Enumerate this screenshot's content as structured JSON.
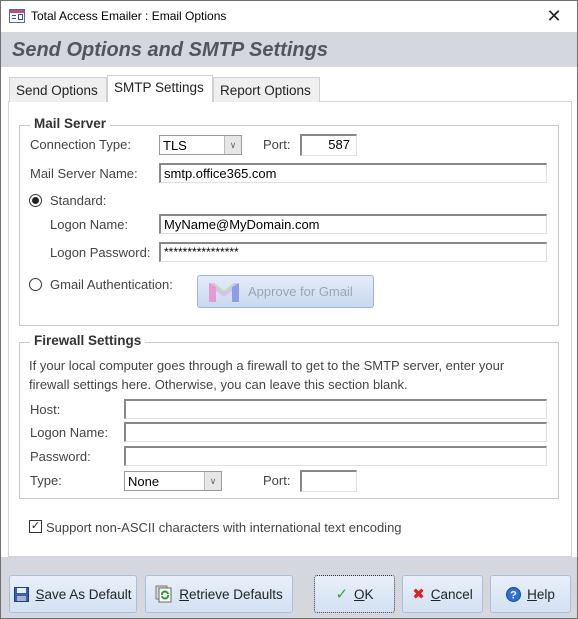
{
  "window": {
    "title": "Total Access Emailer : Email Options",
    "close_glyph": "✕"
  },
  "header": {
    "title": "Send Options and SMTP Settings"
  },
  "tabs": [
    {
      "label": "Send Options",
      "active": false
    },
    {
      "label": "SMTP Settings",
      "active": true
    },
    {
      "label": "Report Options",
      "active": false
    }
  ],
  "mail_server": {
    "group_title": "Mail Server",
    "connection_type_label": "Connection Type:",
    "connection_type_value": "TLS",
    "port_label": "Port:",
    "port_value": "587",
    "server_name_label": "Mail Server Name:",
    "server_name_value": "smtp.office365.com",
    "standard_label": "Standard:",
    "standard_selected": true,
    "logon_name_label": "Logon Name:",
    "logon_name_value": "MyName@MyDomain.com",
    "logon_password_label": "Logon Password:",
    "logon_password_value": "****************",
    "gmail_label": "Gmail Authentication:",
    "gmail_selected": false,
    "gmail_button_label": "Approve for Gmail"
  },
  "firewall": {
    "group_title": "Firewall Settings",
    "description_line1": "If your local computer goes through a firewall to get to the SMTP server, enter your",
    "description_line2": "firewall settings here. Otherwise, you can leave this section blank.",
    "host_label": "Host:",
    "host_value": "",
    "logon_name_label": "Logon Name:",
    "logon_name_value": "",
    "password_label": "Password:",
    "password_value": "",
    "type_label": "Type:",
    "type_value": "None",
    "port_label": "Port:",
    "port_value": ""
  },
  "encoding": {
    "label": "Support non-ASCII characters with international text encoding",
    "checked": true
  },
  "footer": {
    "save_default": {
      "pre": "",
      "mnemonic": "S",
      "post": "ave As Default"
    },
    "retrieve_defaults": {
      "pre": "",
      "mnemonic": "R",
      "post": "etrieve Defaults"
    },
    "ok": {
      "pre": "",
      "mnemonic": "O",
      "post": "K"
    },
    "cancel": {
      "pre": "",
      "mnemonic": "C",
      "post": "ancel"
    },
    "help": {
      "pre": "",
      "mnemonic": "H",
      "post": "elp"
    }
  }
}
